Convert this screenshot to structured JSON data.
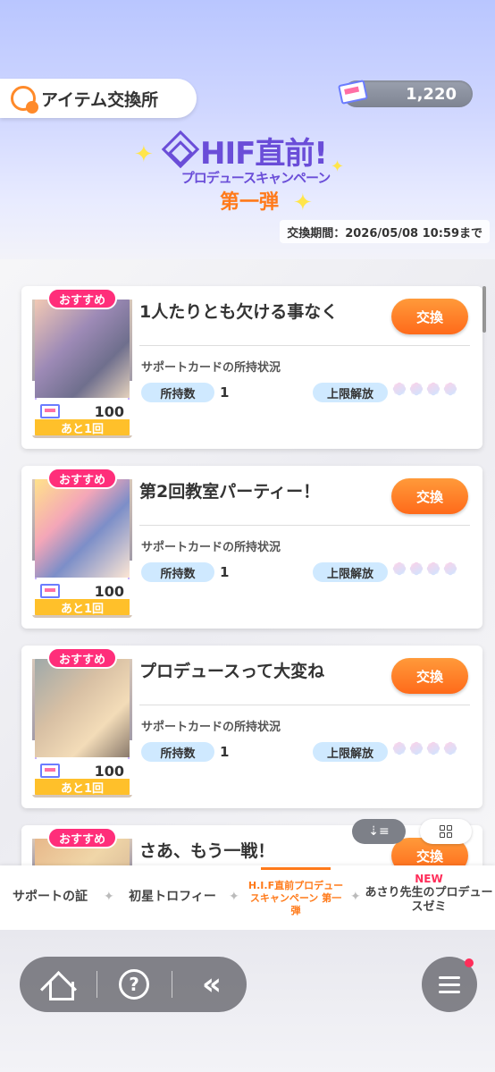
{
  "header": {
    "title": "アイテム交換所",
    "currency_amount": "1,220"
  },
  "banner": {
    "line1": "HIF直前!",
    "line2": "プロデュースキャンペーン",
    "line3": "第一弾",
    "period": "交換期間：2026/05/08 10:59まで"
  },
  "common": {
    "recommended": "おすすめ",
    "exchange": "交換",
    "status_label": "サポートカードの所持状況",
    "owned_label": "所持数",
    "limit_label": "上限解放",
    "price": "100",
    "remaining": "あと1回"
  },
  "items": [
    {
      "title": "1人たりとも欠ける事なく",
      "owned": "1"
    },
    {
      "title": "第2回教室パーティー！",
      "owned": "1"
    },
    {
      "title": "プロデュースって大変ね",
      "owned": "1"
    },
    {
      "title": "さあ、もう一戦！",
      "owned": ""
    }
  ],
  "tabs": [
    {
      "label": "サポートの証"
    },
    {
      "label": "初星トロフィー"
    },
    {
      "label": "H.I.F直前プロデュースキャンペーン 第一弾"
    },
    {
      "badge": "NEW",
      "label": "あさり先生のプロデュースゼミ"
    }
  ],
  "colors": {
    "accent": "#ff7a1a",
    "badge": "#ff2e7a",
    "banner_text": "#6a4dd8"
  },
  "icons": [
    "home-icon",
    "help-icon",
    "back-icon",
    "menu-icon",
    "sort-icon",
    "grid-icon"
  ]
}
